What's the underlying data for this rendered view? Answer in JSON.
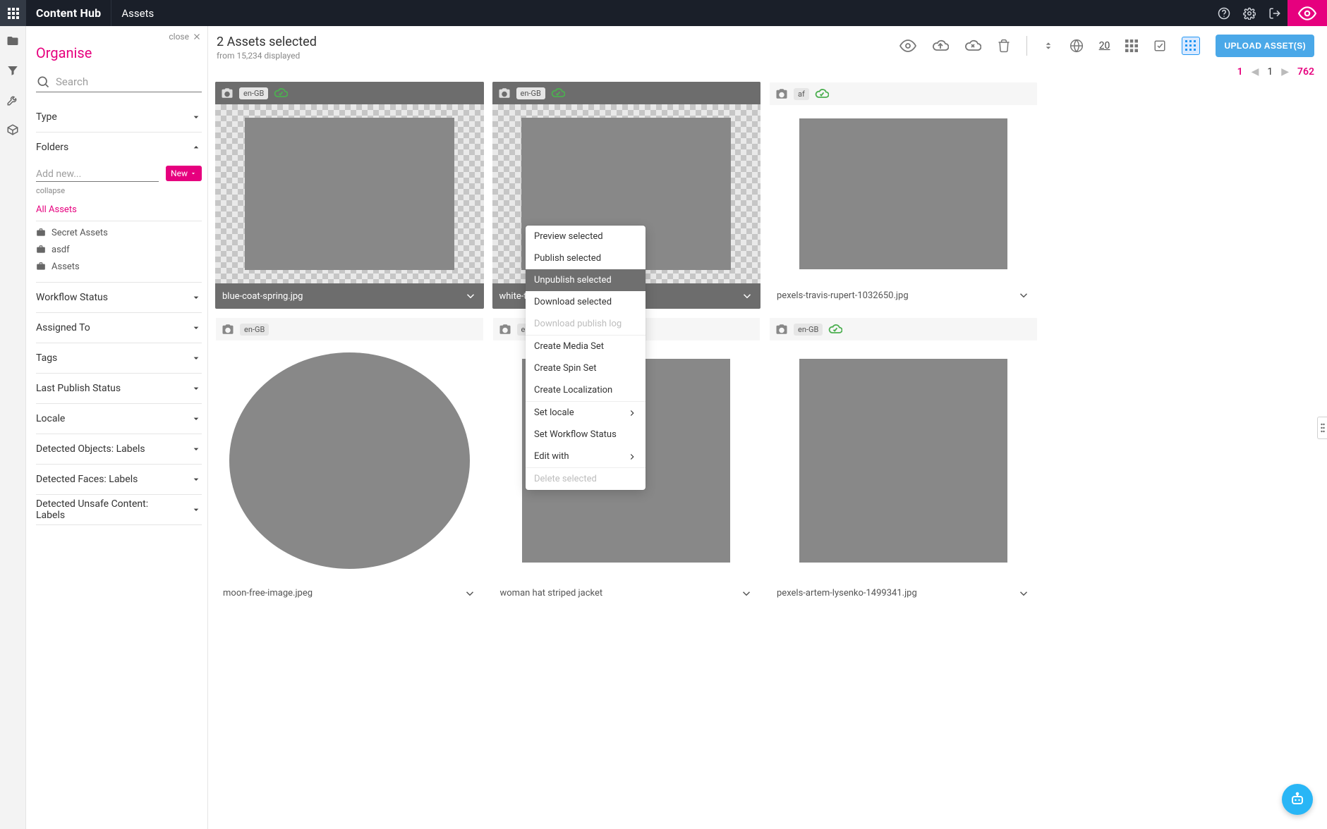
{
  "brand": "Content Hub",
  "breadcrumb": "Assets",
  "topbar_icons": {
    "apps": "apps-icon",
    "help": "help-icon",
    "settings": "gear-icon",
    "logout": "logout-icon",
    "eye": "eye-icon"
  },
  "left": {
    "close": "close",
    "title": "Organise",
    "search_placeholder": "Search",
    "sections": {
      "type": "Type",
      "folders": "Folders",
      "workflow": "Workflow Status",
      "assigned": "Assigned To",
      "tags": "Tags",
      "last_publish": "Last Publish Status",
      "locale": "Locale",
      "det_obj": "Detected Objects: Labels",
      "det_face": "Detected Faces: Labels",
      "det_unsafe": "Detected Unsafe Content: Labels"
    },
    "folders": {
      "add_placeholder": "Add new...",
      "new_btn": "New",
      "collapse": "collapse",
      "items": [
        {
          "label": "All Assets",
          "active": true,
          "icon": false
        },
        {
          "label": "Secret Assets",
          "active": false,
          "icon": true
        },
        {
          "label": "asdf",
          "active": false,
          "icon": true
        },
        {
          "label": "Assets",
          "active": false,
          "icon": true
        }
      ]
    }
  },
  "toolbar": {
    "selected_title": "2 Assets selected",
    "selected_sub": "from 15,234 displayed",
    "page_size": "20",
    "upload": "UPLOAD ASSET(S)"
  },
  "pager": {
    "first": "1",
    "current": "1",
    "last": "762"
  },
  "cards": [
    {
      "locale": "en-GB",
      "published": true,
      "selected": true,
      "filename": "blue-coat-spring.jpg",
      "thumb": "g1"
    },
    {
      "locale": "en-GB",
      "published": true,
      "selected": true,
      "filename": "white-top-spring.jpg",
      "thumb": "g2"
    },
    {
      "locale": "af",
      "published": true,
      "selected": false,
      "filename": "pexels-travis-rupert-1032650.jpg",
      "thumb": "g3"
    },
    {
      "locale": "en-GB",
      "published": false,
      "selected": false,
      "filename": "moon-free-image.jpeg",
      "thumb": "g4"
    },
    {
      "locale": "en-GB",
      "published": false,
      "selected": false,
      "filename": "woman hat striped jacket",
      "thumb": "g5"
    },
    {
      "locale": "en-GB",
      "published": true,
      "selected": false,
      "filename": "pexels-artem-lysenko-1499341.jpg",
      "thumb": "g6"
    }
  ],
  "context_menu": [
    {
      "label": "Preview selected",
      "state": ""
    },
    {
      "label": "Publish selected",
      "state": ""
    },
    {
      "label": "Unpublish selected",
      "state": "hover"
    },
    {
      "label": "Download selected",
      "state": ""
    },
    {
      "label": "Download publish log",
      "state": "disabled"
    },
    {
      "sep": true
    },
    {
      "label": "Create Media Set",
      "state": ""
    },
    {
      "label": "Create Spin Set",
      "state": ""
    },
    {
      "label": "Create Localization",
      "state": ""
    },
    {
      "sep": true
    },
    {
      "label": "Set locale",
      "state": "",
      "submenu": true
    },
    {
      "label": "Set Workflow Status",
      "state": ""
    },
    {
      "label": "Edit with",
      "state": "",
      "submenu": true
    },
    {
      "sep": true
    },
    {
      "label": "Delete selected",
      "state": "disabled"
    }
  ]
}
